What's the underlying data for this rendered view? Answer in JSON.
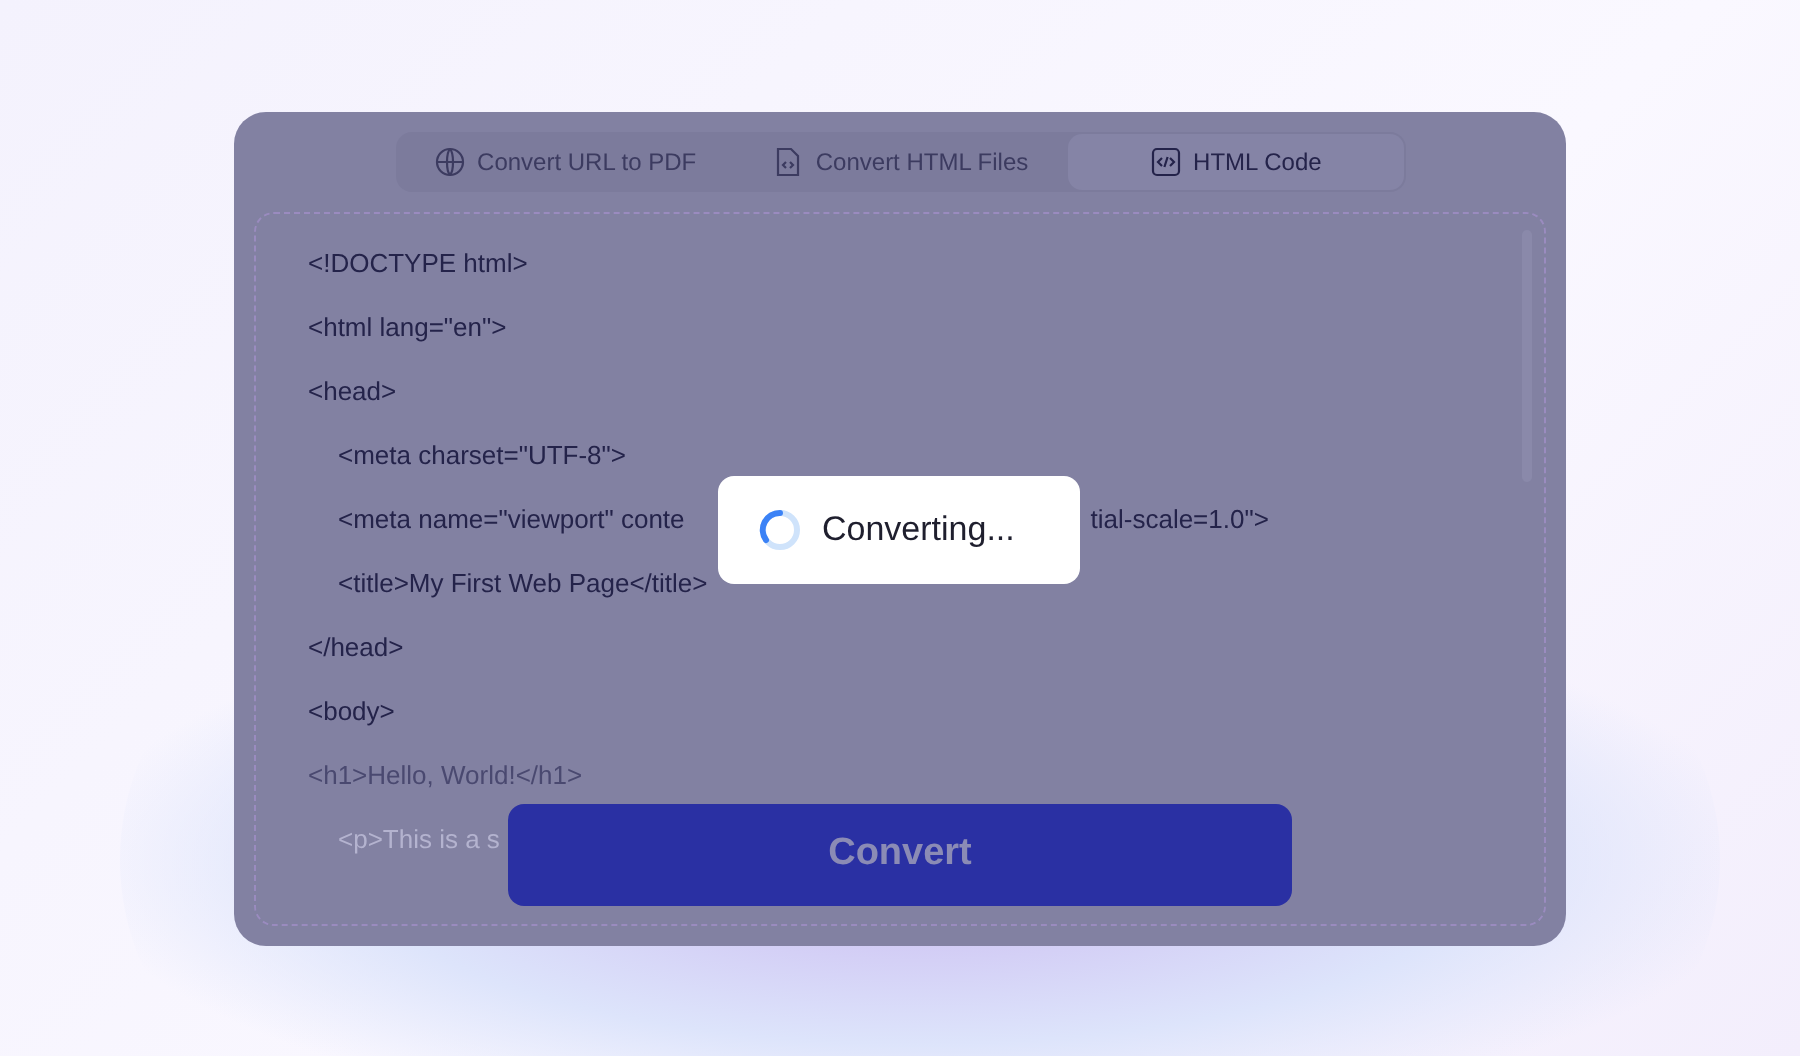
{
  "tabs": [
    {
      "label": "Convert URL to PDF",
      "kind": "globe",
      "selected": false
    },
    {
      "label": "Convert HTML Files",
      "kind": "file",
      "selected": false
    },
    {
      "label": "HTML Code",
      "kind": "code",
      "selected": true
    }
  ],
  "code_lines": [
    {
      "text": "<!DOCTYPE html>",
      "kind": "plain",
      "faded": false
    },
    {
      "text": "<html lang=\"en\">",
      "kind": "plain",
      "faded": false
    },
    {
      "text": "<head>",
      "kind": "plain",
      "faded": false
    },
    {
      "text": "<meta charset=\"UTF-8\">",
      "kind": "indented",
      "faded": false
    },
    {
      "text": "<meta name=\"viewport\" conte",
      "rest": "tial-scale=1.0\">",
      "kind": "indented",
      "faded": false
    },
    {
      "text": "<title>My First Web Page</title>",
      "kind": "indented",
      "faded": false
    },
    {
      "text": "</head>",
      "kind": "plain",
      "faded": false
    },
    {
      "text": "<body>",
      "kind": "plain",
      "faded": false
    },
    {
      "text": "<h1>Hello, World!</h1>",
      "kind": "plain",
      "faded": true
    },
    {
      "text": "<p>This is a s",
      "kind": "indented",
      "faded": true
    }
  ],
  "progress": {
    "label": "Converting..."
  },
  "convert_button": {
    "label": "Convert"
  }
}
